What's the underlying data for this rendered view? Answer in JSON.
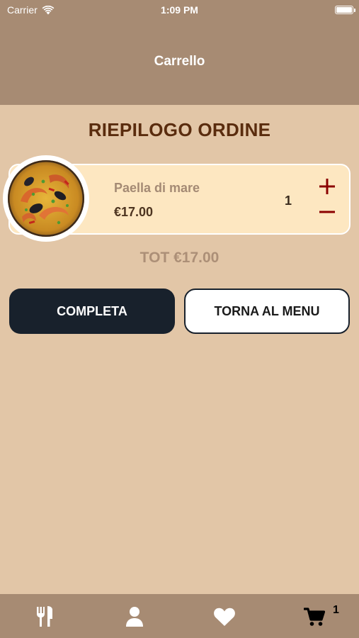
{
  "status_bar": {
    "carrier": "Carrier",
    "time": "1:09 PM",
    "battery_level": 1.0
  },
  "header": {
    "title": "Carrello"
  },
  "order": {
    "title": "RIEPILOGO ORDINE",
    "items": [
      {
        "name": "Paella di mare",
        "price": "€17.00",
        "quantity": "1",
        "image": "paella-photo"
      }
    ],
    "total": "TOT €17.00"
  },
  "actions": {
    "complete_label": "COMPLETA",
    "back_to_menu_label": "TORNA AL MENU"
  },
  "tabbar": {
    "tabs": [
      {
        "icon": "utensils-icon"
      },
      {
        "icon": "user-icon"
      },
      {
        "icon": "heart-icon"
      },
      {
        "icon": "cart-icon"
      }
    ],
    "cart_badge": "1"
  },
  "colors": {
    "header_bg": "#a78b73",
    "page_bg": "#e2c6a7",
    "title": "#5a2c0e",
    "card_bg": "#fde7c1",
    "qty_controls": "#8b0000",
    "primary_button": "#18212c"
  }
}
